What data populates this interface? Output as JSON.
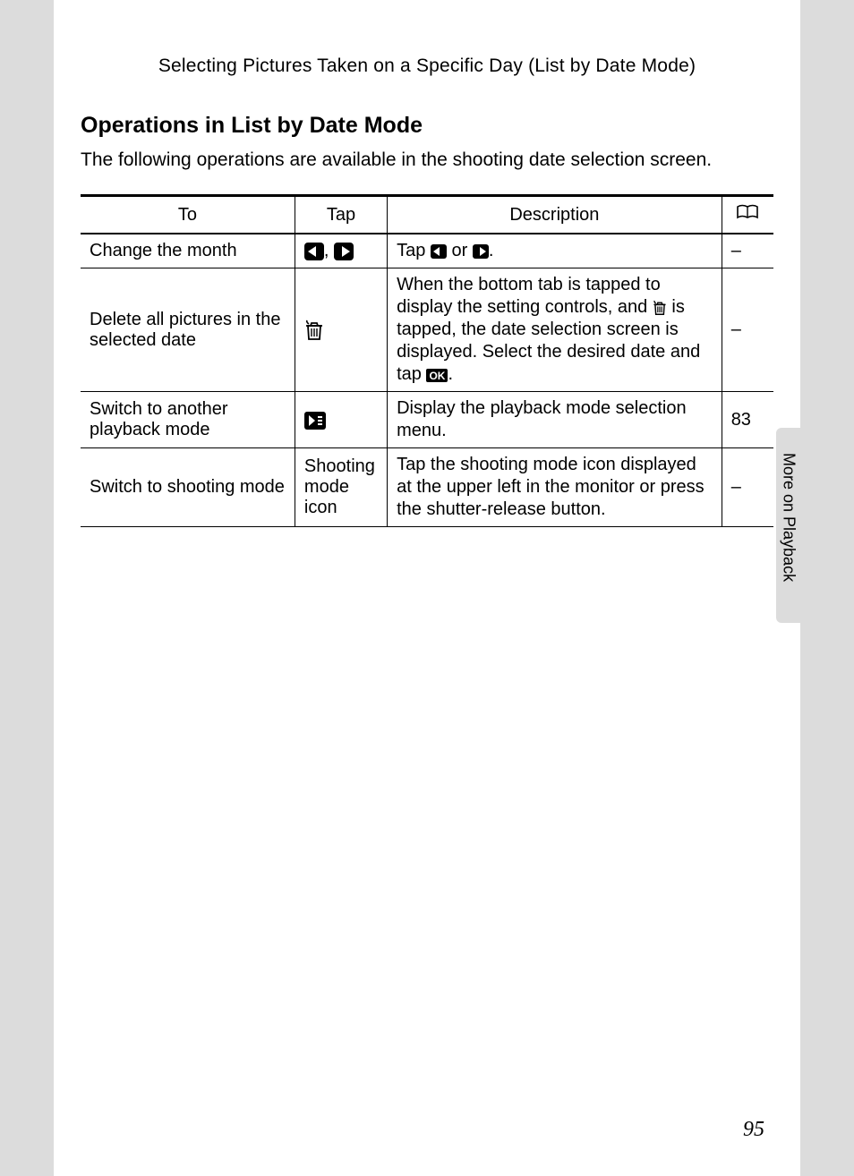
{
  "header": {
    "title": "Selecting Pictures Taken on a Specific Day (List by Date Mode)"
  },
  "section": {
    "title": "Operations in List by Date Mode",
    "intro": "The following operations are available in the shooting date selection screen."
  },
  "table": {
    "headers": {
      "to": "To",
      "tap": "Tap",
      "description": "Description"
    },
    "rows": [
      {
        "to": "Change the month",
        "tap_icon": "left-right-arrows",
        "desc_prefix": "Tap ",
        "desc_mid": " or ",
        "desc_suffix": ".",
        "ref": "–"
      },
      {
        "to": "Delete all pictures in the selected date",
        "tap_icon": "trash",
        "desc_prefix": "When the bottom tab is tapped to display the setting controls, and ",
        "desc_mid": " is tapped, the date selection screen is displayed. Select the desired date and tap ",
        "desc_suffix": ".",
        "ok_label": "OK",
        "ref": "–"
      },
      {
        "to": "Switch to another playback mode",
        "tap_icon": "playback",
        "desc": "Display the playback mode selection menu.",
        "ref": "83"
      },
      {
        "to": "Switch to shooting mode",
        "tap_text": "Shooting mode icon",
        "desc": "Tap the shooting mode icon displayed at the upper left in the monitor or press the shutter-release button.",
        "ref": "–"
      }
    ]
  },
  "side_tab": "More on Playback",
  "page_number": "95"
}
